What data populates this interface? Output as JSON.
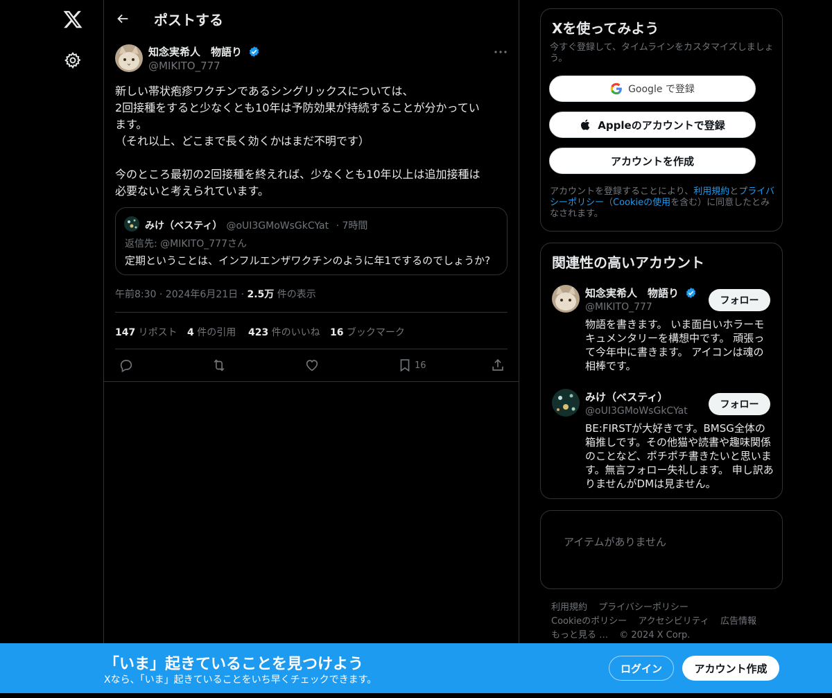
{
  "nav": {
    "logo": "x-logo-icon",
    "settings": "gear-icon"
  },
  "header": {
    "title": "ポストする"
  },
  "tweet": {
    "author_name": "知念実希人　物語り",
    "author_handle": "@MIKITO_777",
    "text_lines": [
      "新しい帯状疱疹ワクチンであるシングリックスについては、",
      "2回接種をすると少なくとも10年は予防効果が持続することが分かってい",
      "ます。",
      "（それ以上、どこまで長く効くかはまだ不明です）",
      "",
      "今のところ最初の2回接種を終えれば、少なくとも10年以上は追加接種は",
      "必要ないと考えられています。"
    ],
    "quote": {
      "name": "みけ（ベスティ）",
      "handle": "@oUI3GMoWsGkCYat",
      "time": "· 7時間",
      "reply_to": "返信先: @MIKITO_777さん",
      "text": "定期ということは、インフルエンザワクチンのように年1でするのでしょうか?"
    },
    "meta": {
      "time": "午前8:30 · 2024年6月21日 · ",
      "views": "2.5万",
      "views_label": " 件の表示"
    },
    "stats": {
      "reposts": "147",
      "reposts_label": " リポスト",
      "quotes": "4",
      "quotes_label": " 件の引用",
      "likes": "423",
      "likes_label": " 件のいいね",
      "bookmarks": "16",
      "bookmarks_label": " ブックマーク"
    },
    "bookmark_count": "16"
  },
  "signup": {
    "title": "Xを使ってみよう",
    "subtitle": "今すぐ登録して、タイムラインをカスタマイズしましょう。",
    "google_label": "Google で登録",
    "apple_label": "Appleのアカウントで登録",
    "create_label": "アカウントを作成",
    "legal_prefix": "アカウントを登録することにより、",
    "terms": "利用規約",
    "and": "と",
    "privacy": "プライバシーポリシー",
    "paren_open": "（",
    "cookie": "Cookieの使用",
    "legal_suffix": "を含む）に同意したとみなされます。"
  },
  "relevant": {
    "title": "関連性の高いアカウント",
    "follow_label": "フォロー",
    "accounts": [
      {
        "name": "知念実希人　物語り",
        "handle": "@MIKITO_777",
        "bio": "物語を書きます。 いま面白いホラーモキュメンタリーを構想中です。 頑張って今年中に書きます。 アイコンは魂の相棒です。"
      },
      {
        "name": "みけ（ベスティ）",
        "handle": "@oUI3GMoWsGkCYat",
        "bio": "BE:FIRSTが大好きです。BMSG全体の箱推しです。その他猫や読書や趣味関係のことなど、ポチポチ書きたいと思います。無言フォロー失礼します。 申し訳ありませんがDMは見ません。"
      }
    ]
  },
  "trends": {
    "empty": "アイテムがありません"
  },
  "footer": {
    "terms": "利用規約",
    "privacy": "プライバシーポリシー",
    "cookie": "Cookieのポリシー",
    "accessibility": "アクセシビリティ",
    "ads": "広告情報",
    "more": "もっと見る …",
    "copyright": "© 2024 X Corp."
  },
  "banner": {
    "title": "「いま」起きていることを見つけよう",
    "subtitle": "Xなら、「いま」起きていることをいち早くチェックできます。",
    "login": "ログイン",
    "create": "アカウント作成"
  },
  "colors": {
    "accent": "#1d9bf0",
    "background": "#000000",
    "border": "#2f3336",
    "muted": "#71767b"
  }
}
